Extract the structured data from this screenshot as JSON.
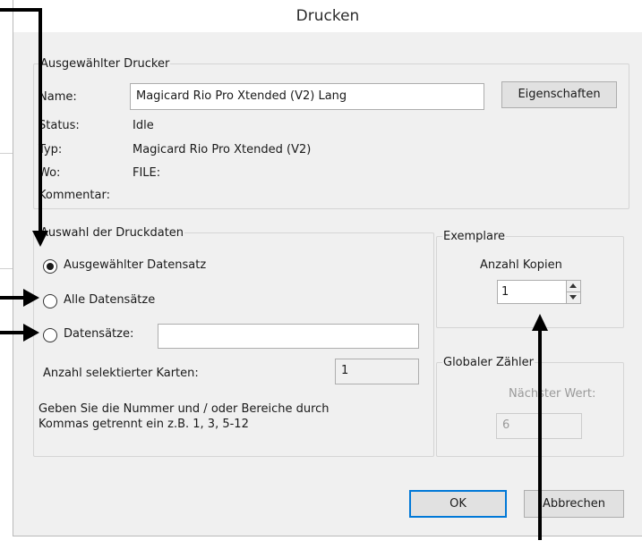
{
  "dialog": {
    "title": "Drucken"
  },
  "printer_group": {
    "legend": "Ausgewählter Drucker",
    "name_label": "Name:",
    "name_value": "Magicard Rio Pro Xtended (V2) Lang",
    "properties_button": "Eigenschaften",
    "status_label": "Status:",
    "status_value": "Idle",
    "type_label": "Typ:",
    "type_value": "Magicard Rio Pro Xtended (V2)",
    "where_label": "Wo:",
    "where_value": "FILE:",
    "comment_label": "Kommentar:",
    "comment_value": ""
  },
  "selection_group": {
    "legend": "Auswahl der Druckdaten",
    "options": [
      {
        "label": "Ausgewählter Datensatz",
        "checked": true
      },
      {
        "label": "Alle Datensätze",
        "checked": false
      },
      {
        "label": "Datensätze:",
        "checked": false
      }
    ],
    "records_input_value": "",
    "selected_cards_label": "Anzahl selektierter Karten:",
    "selected_cards_value": "1",
    "hint": "Geben Sie die  Nummer und / oder Bereiche durch\nKommas getrennt ein z.B. 1, 3, 5-12"
  },
  "copies_group": {
    "legend": "Exemplare",
    "copies_label": "Anzahl Kopien",
    "copies_value": "1"
  },
  "counter_group": {
    "legend": "Globaler Zähler",
    "next_label": "Nächster Wert:",
    "next_value": "6"
  },
  "buttons": {
    "ok": "OK",
    "cancel": "Abbrechen"
  },
  "colors": {
    "accent": "#0078d7",
    "annotation_arrows": "#000000"
  },
  "icons": [
    "spin-up-icon",
    "spin-down-icon",
    "callout-arrow-icon"
  ]
}
